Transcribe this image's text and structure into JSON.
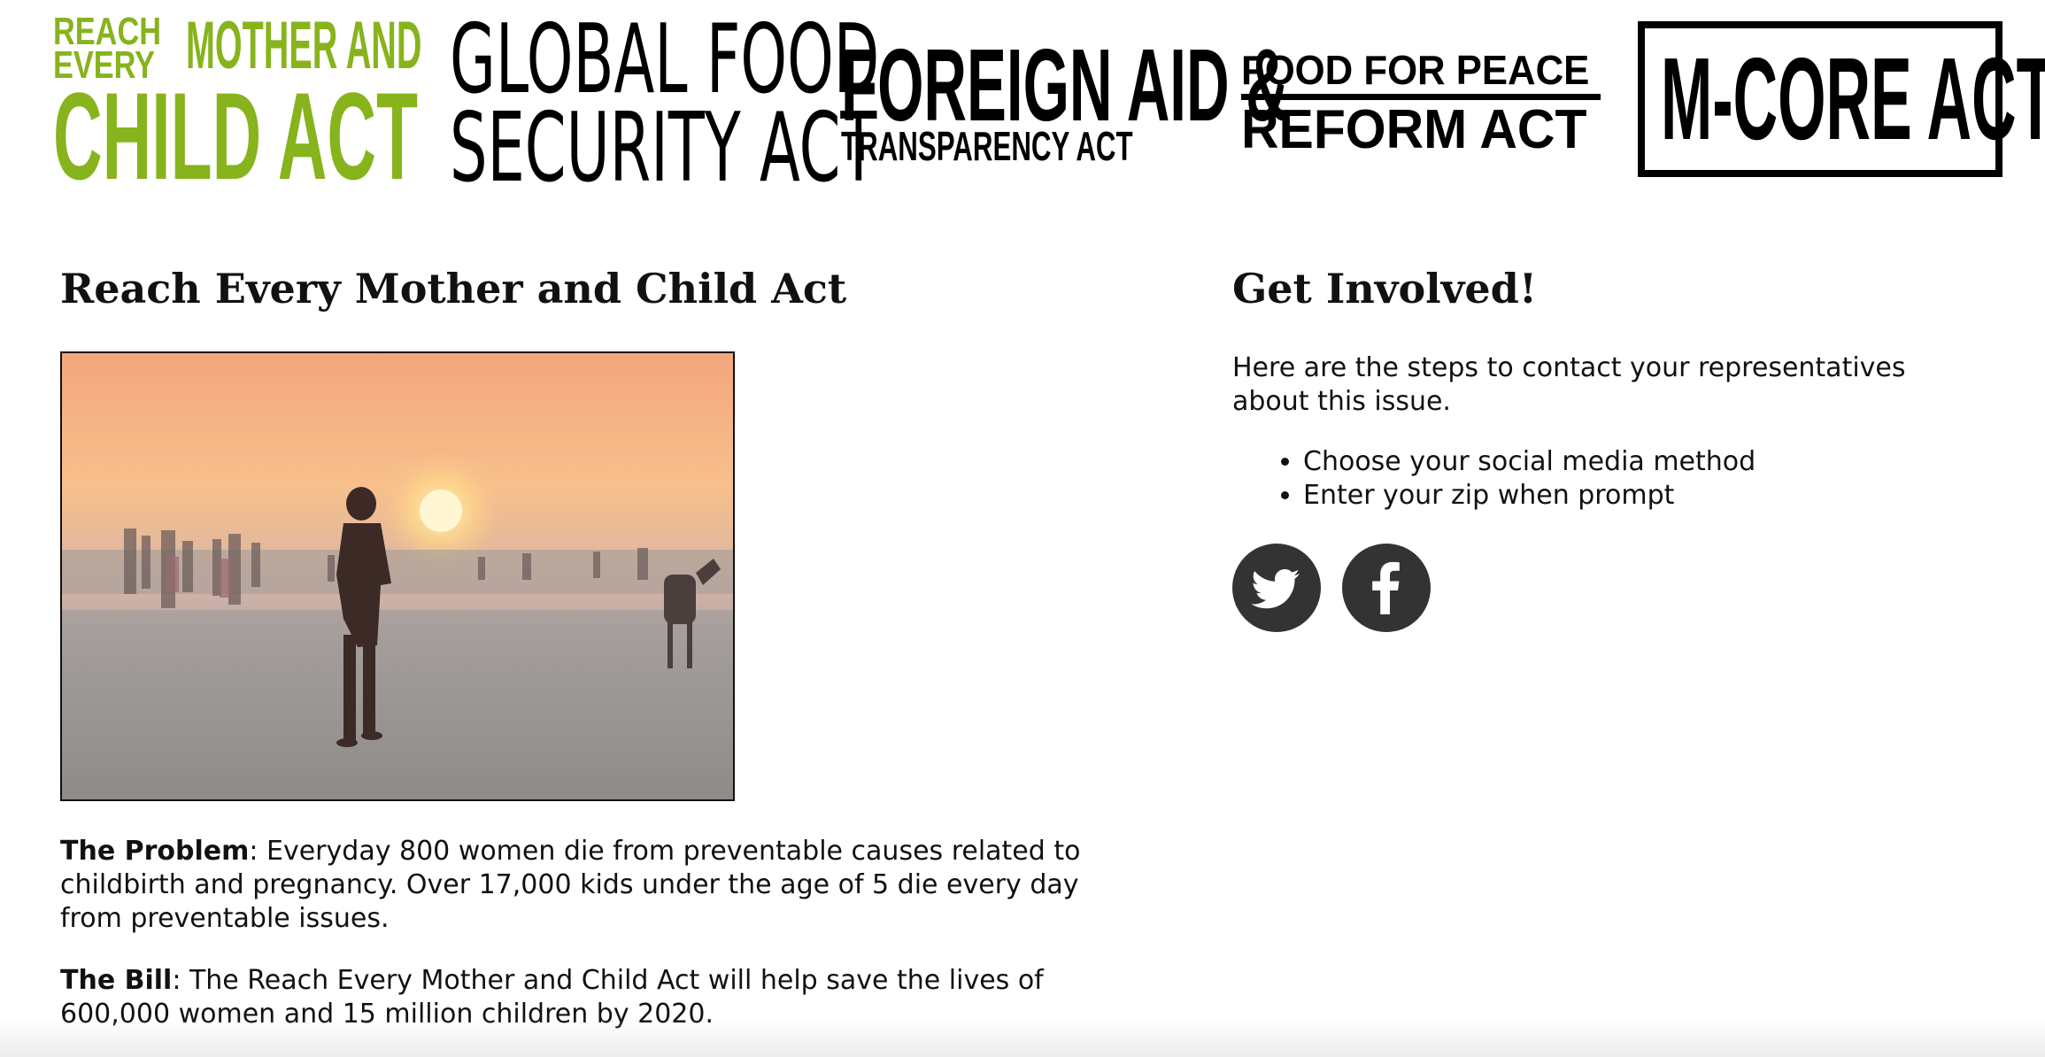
{
  "act_nav": {
    "reach_every_mother": {
      "line1": "REACH",
      "line2": "EVERY",
      "line3": "MOTHER AND",
      "line4": "CHILD ACT",
      "color": "#87b31c"
    },
    "global_food_security": {
      "line1": "GLOBAL FOOD",
      "line2": "SECURITY ACT"
    },
    "foreign_aid": {
      "line1": "FOREIGN AID &",
      "line2": "TRANSPARENCY ACT"
    },
    "food_for_peace": {
      "line1": "FOOD FOR PEACE",
      "line2": "REFORM ACT"
    },
    "m_core": {
      "line1": "M-CORE ACT"
    }
  },
  "main": {
    "title": "Reach Every Mother and Child Act",
    "problem_label": "The Problem",
    "problem_text": ": Everyday 800 women die from preventable causes related to childbirth and pregnancy. Over 17,000 kids under the age of 5 die every day from preventable issues.",
    "bill_label": "The Bill",
    "bill_text": ": The Reach Every Mother and Child Act will help save the lives of 600,000 women and 15 million children by 2020."
  },
  "get_involved": {
    "title": "Get Involved!",
    "intro": "Here are the steps to contact your representatives about this issue.",
    "steps": [
      "Choose your social media method",
      "Enter your zip when prompt"
    ],
    "social_buttons": [
      {
        "icon": "twitter-bird-icon"
      },
      {
        "icon": "facebook-f-icon"
      }
    ]
  },
  "colors": {
    "accent_green": "#87b31c",
    "text": "#111111",
    "social_circle": "#333333"
  }
}
